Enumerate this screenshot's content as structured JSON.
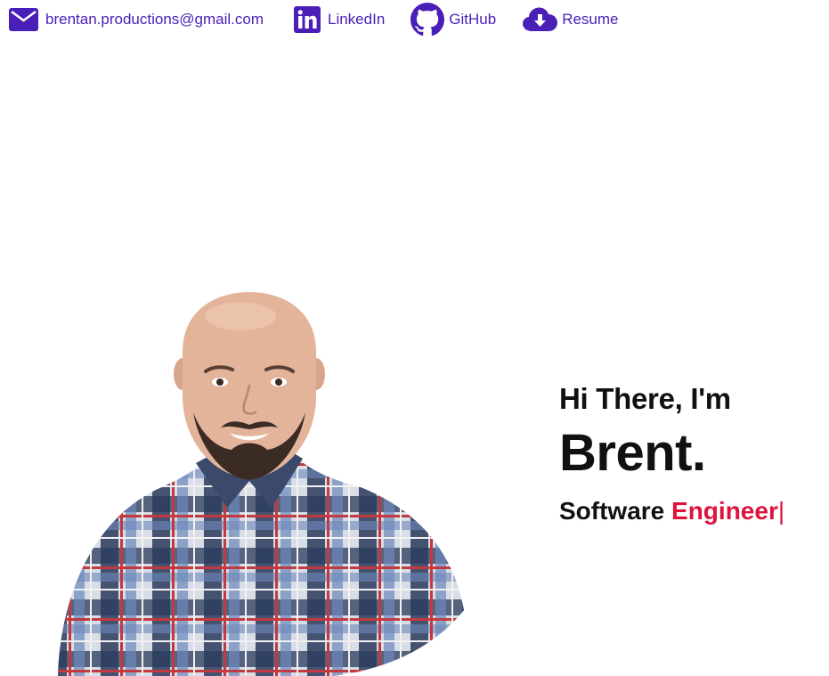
{
  "contacts": {
    "email": {
      "label": "brentan.productions@gmail.com",
      "icon": "mail-icon"
    },
    "linkedin": {
      "label": "LinkedIn",
      "icon": "linkedin-icon"
    },
    "github": {
      "label": "GitHub",
      "icon": "github-icon"
    },
    "resume": {
      "label": "Resume",
      "icon": "cloud-download-icon"
    }
  },
  "hero": {
    "greeting": "Hi There, I'm",
    "name": "Brent.",
    "role_prefix": "Software",
    "role_accent": "Engineer",
    "cursor": "|"
  },
  "colors": {
    "link": "#4a1fb8",
    "accent": "#dc143c",
    "text": "#111111"
  }
}
